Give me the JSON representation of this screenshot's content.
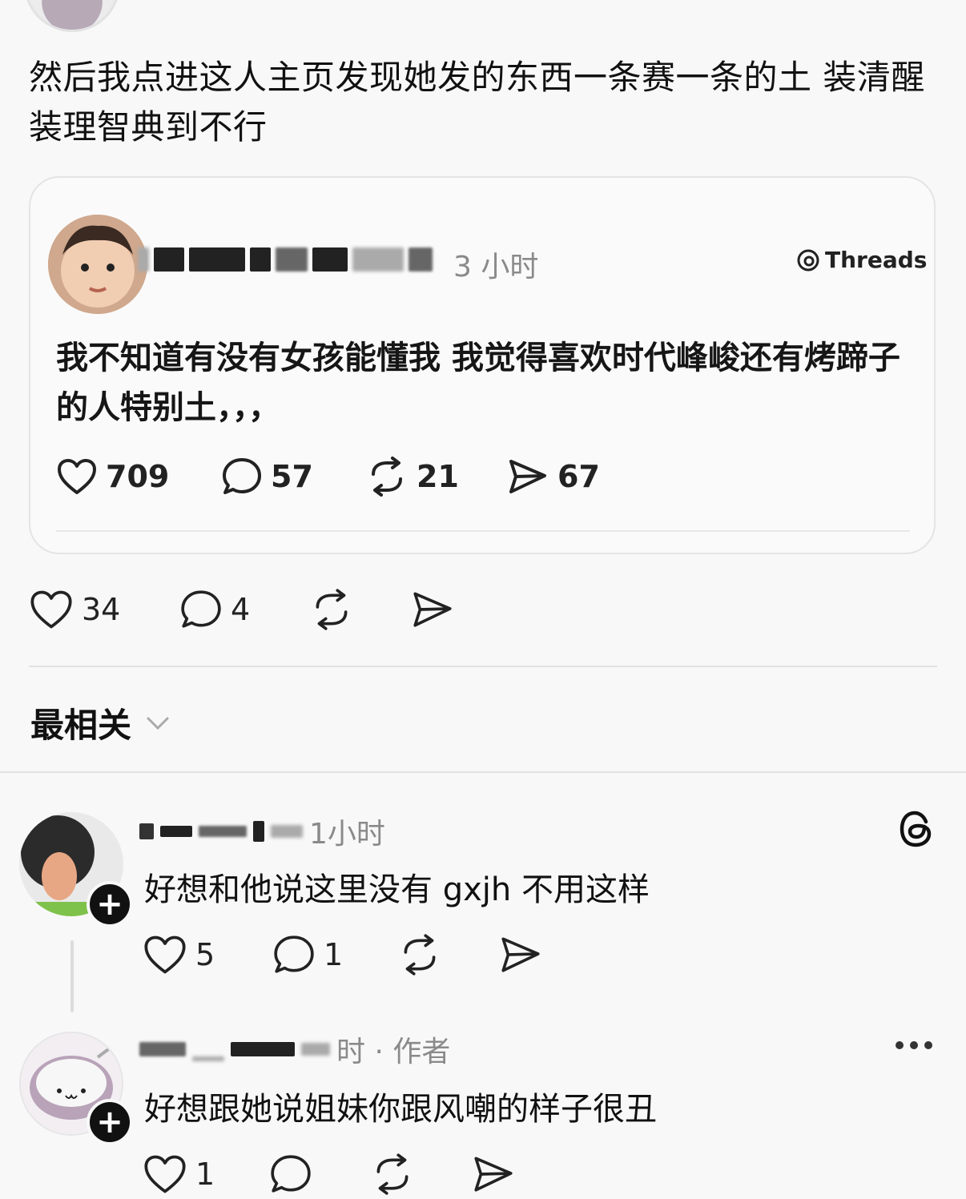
{
  "post": {
    "text": "然后我点进这人主页发现她发的东西一条赛一条的土 装清醒装理智典到不行"
  },
  "quote": {
    "time": "3 小时",
    "source_label": "Threads",
    "text": "我不知道有没有女孩能懂我  我觉得喜欢时代峰峻还有烤蹄子的人特别土，，，",
    "likes": "709",
    "replies": "57",
    "reposts": "21",
    "shares": "67"
  },
  "post_stats": {
    "likes": "34",
    "replies": "4"
  },
  "sort": {
    "label": "最相关"
  },
  "comments": [
    {
      "time": "1小时",
      "text": "好想和他说这里没有 gxjh 不用这样",
      "likes": "5",
      "replies": "1"
    },
    {
      "time": "时 · 作者",
      "text": "好想跟她说姐妹你跟风嘲的样子很丑",
      "likes": "1"
    }
  ],
  "icons": {
    "like": "heart-icon",
    "reply": "comment-bubble-icon",
    "repost": "repost-icon",
    "share": "send-icon",
    "threads": "threads-logo-icon",
    "more": "more-icon",
    "follow": "plus-icon",
    "sort_dropdown": "chevron-down-icon"
  }
}
